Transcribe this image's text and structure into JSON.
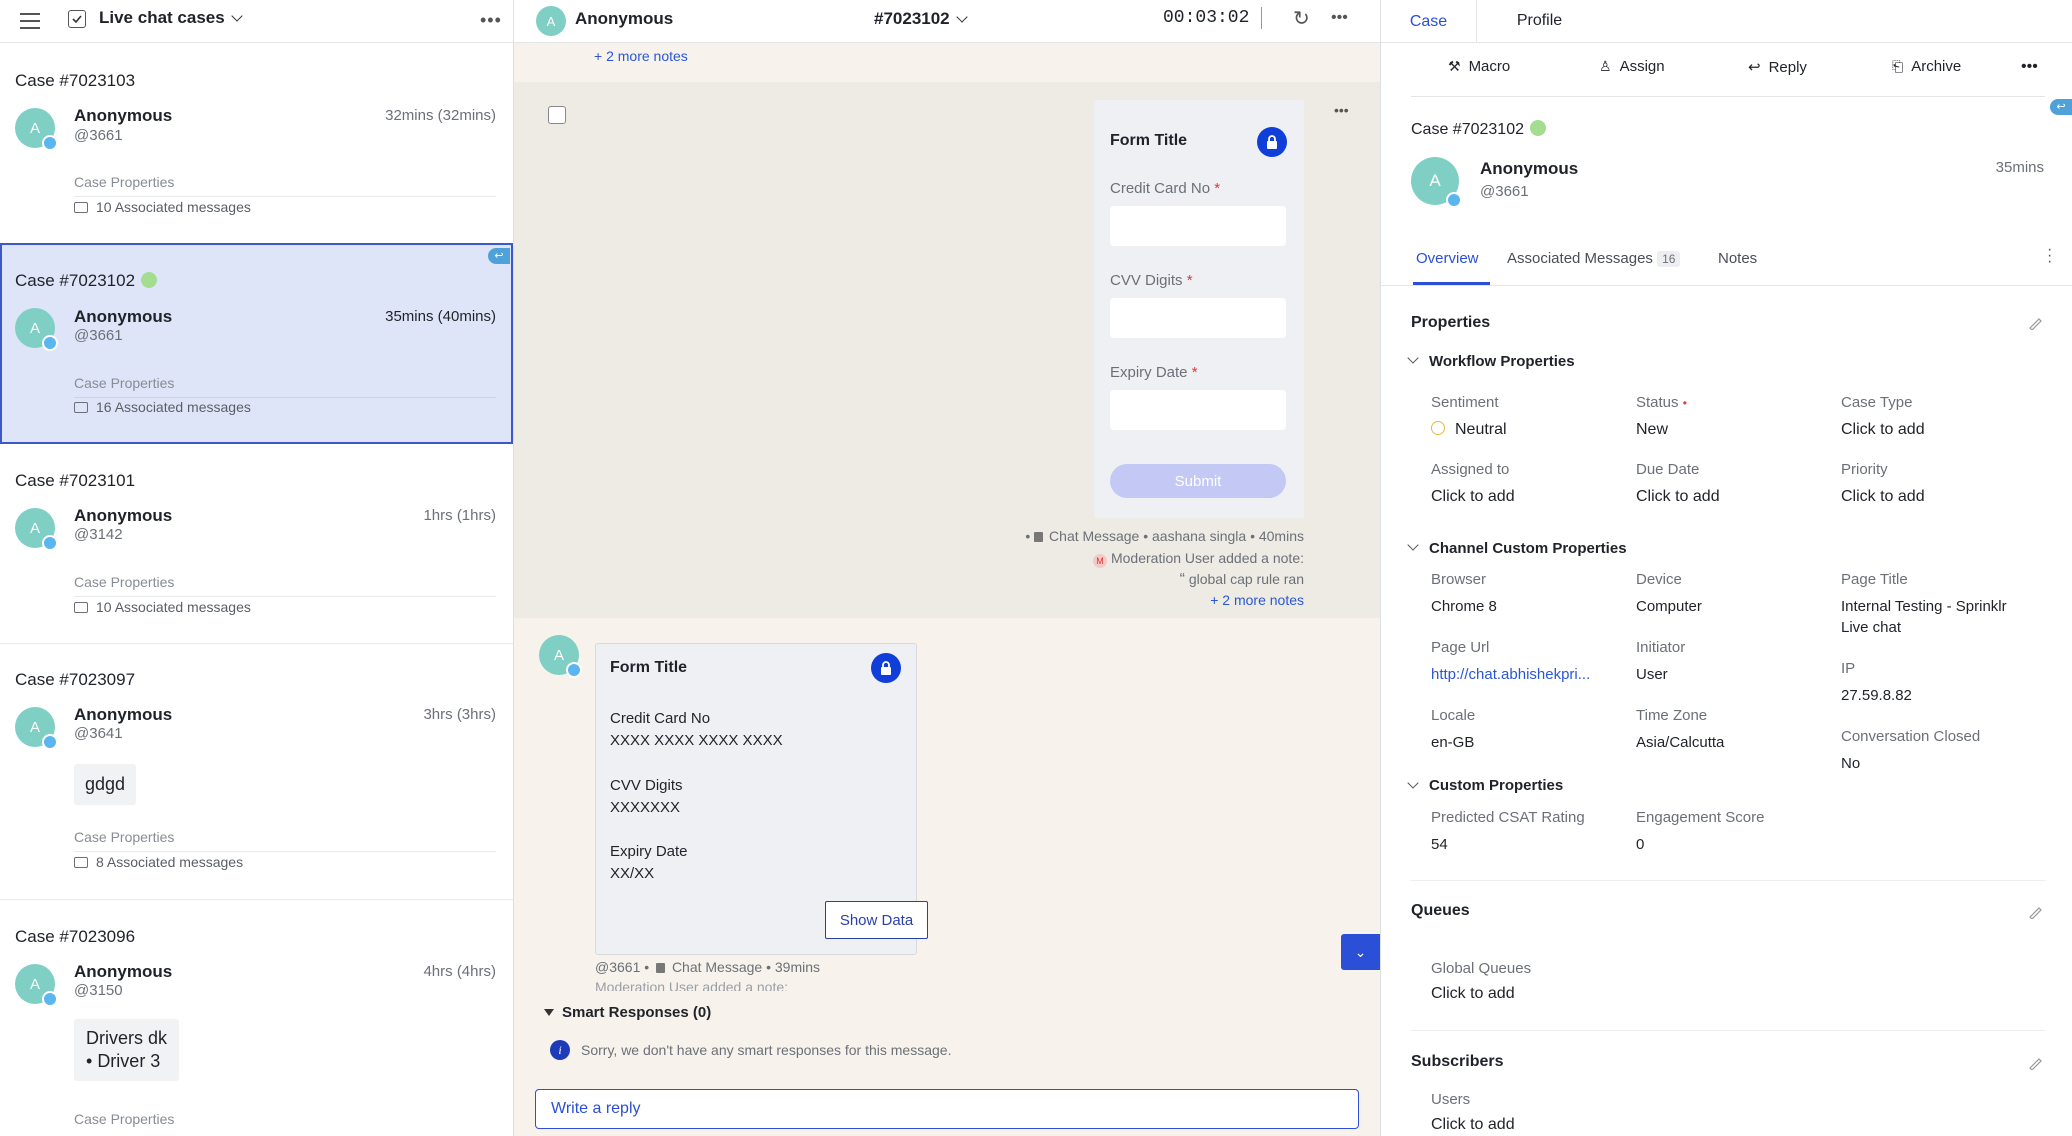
{
  "left_panel": {
    "title": "Live chat cases",
    "cases": [
      {
        "id": "Case #7023103",
        "name": "Anonymous",
        "handle": "@3661",
        "time": "32mins (32mins)",
        "properties": "Case Properties",
        "messages": "10 Associated messages",
        "avatar": "A"
      },
      {
        "id": "Case #7023102",
        "name": "Anonymous",
        "handle": "@3661",
        "time": "35mins (40mins)",
        "properties": "Case Properties",
        "messages": "16 Associated messages",
        "avatar": "A"
      },
      {
        "id": "Case #7023101",
        "name": "Anonymous",
        "handle": "@3142",
        "time": "1hrs (1hrs)",
        "properties": "Case Properties",
        "messages": "10 Associated messages",
        "avatar": "A"
      },
      {
        "id": "Case #7023097",
        "name": "Anonymous",
        "handle": "@3641",
        "time": "3hrs (3hrs)",
        "bubble": "gdgd",
        "properties": "Case Properties",
        "messages": "8 Associated messages",
        "avatar": "A"
      },
      {
        "id": "Case #7023096",
        "name": "Anonymous",
        "handle": "@3150",
        "time": "4hrs (4hrs)",
        "bubble_title": "Drivers dk",
        "bubble_item": "Driver 3",
        "properties": "Case Properties",
        "avatar": "A"
      }
    ]
  },
  "conversation": {
    "header_name": "Anonymous",
    "header_case": "#7023102",
    "timer": "00:03:02",
    "top_more_notes": "+ 2 more notes",
    "form1": {
      "title": "Form Title",
      "field1": "Credit Card No",
      "field2": "CVV Digits",
      "field3": "Expiry Date",
      "required": "*",
      "submit": "Submit"
    },
    "meta1": "Chat Message • aashana singla • 40mins",
    "note1": "Moderation User added a note:",
    "note1_quote": "global cap rule ran",
    "more_notes": "+ 2 more notes",
    "form2": {
      "title": "Form Title",
      "field1": "Credit Card No",
      "value1": "XXXX XXXX XXXX XXXX",
      "field2": "CVV Digits",
      "value2": "XXXXXXX",
      "field3": "Expiry Date",
      "value3": "XX/XX",
      "show_data": "Show Data"
    },
    "meta2_handle": "@3661 •",
    "meta2": "Chat Message • 39mins",
    "note2": "Moderation User added a note:",
    "smart_title": "Smart Responses (0)",
    "smart_msg": "Sorry, we don't have any smart responses for this message.",
    "reply_placeholder": "Write a reply",
    "avatar": "A"
  },
  "right_panel": {
    "tabs": [
      "Case",
      "Profile"
    ],
    "actions": [
      "Macro",
      "Assign",
      "Reply",
      "Archive"
    ],
    "case_id": "Case #7023102",
    "name": "Anonymous",
    "handle": "@3661",
    "time": "35mins",
    "avatar": "A",
    "subtabs": {
      "overview": "Overview",
      "associated": "Associated Messages",
      "associated_count": "16",
      "notes": "Notes"
    },
    "properties_title": "Properties",
    "workflow_title": "Workflow Properties",
    "workflow": [
      {
        "label": "Sentiment",
        "value": "Neutral"
      },
      {
        "label": "Status",
        "value": "New"
      },
      {
        "label": "Case Type",
        "value": "Click to add"
      },
      {
        "label": "Assigned to",
        "value": "Click to add"
      },
      {
        "label": "Due Date",
        "value": "Click to add"
      },
      {
        "label": "Priority",
        "value": "Click to add"
      }
    ],
    "channel_title": "Channel Custom Properties",
    "channel": [
      {
        "label": "Browser",
        "value": "Chrome 8"
      },
      {
        "label": "Device",
        "value": "Computer"
      },
      {
        "label": "Page Title",
        "value": "Internal Testing - Sprinklr",
        "value2": "Live chat"
      },
      {
        "label": "Page Url",
        "value": "http://chat.abhishekpri..."
      },
      {
        "label": "Initiator",
        "value": "User"
      },
      {
        "label": "IP",
        "value": "27.59.8.82"
      },
      {
        "label": "Locale",
        "value": "en-GB"
      },
      {
        "label": "Time Zone",
        "value": "Asia/Calcutta"
      },
      {
        "label": "Conversation Closed",
        "value": "No"
      }
    ],
    "custom_title": "Custom Properties",
    "custom": [
      {
        "label": "Predicted CSAT Rating",
        "value": "54"
      },
      {
        "label": "Engagement Score",
        "value": "0"
      }
    ],
    "queues_title": "Queues",
    "queues_label": "Global Queues",
    "queues_value": "Click to add",
    "subscribers_title": "Subscribers",
    "subscribers_label": "Users",
    "subscribers_value": "Click to add"
  },
  "colors": {
    "accent": "#0f3fd8",
    "selected_bg": "#dfe5f8",
    "selected_border": "#3d58c9",
    "avatar": "#7fcfc5",
    "online": "#a4dc90"
  }
}
